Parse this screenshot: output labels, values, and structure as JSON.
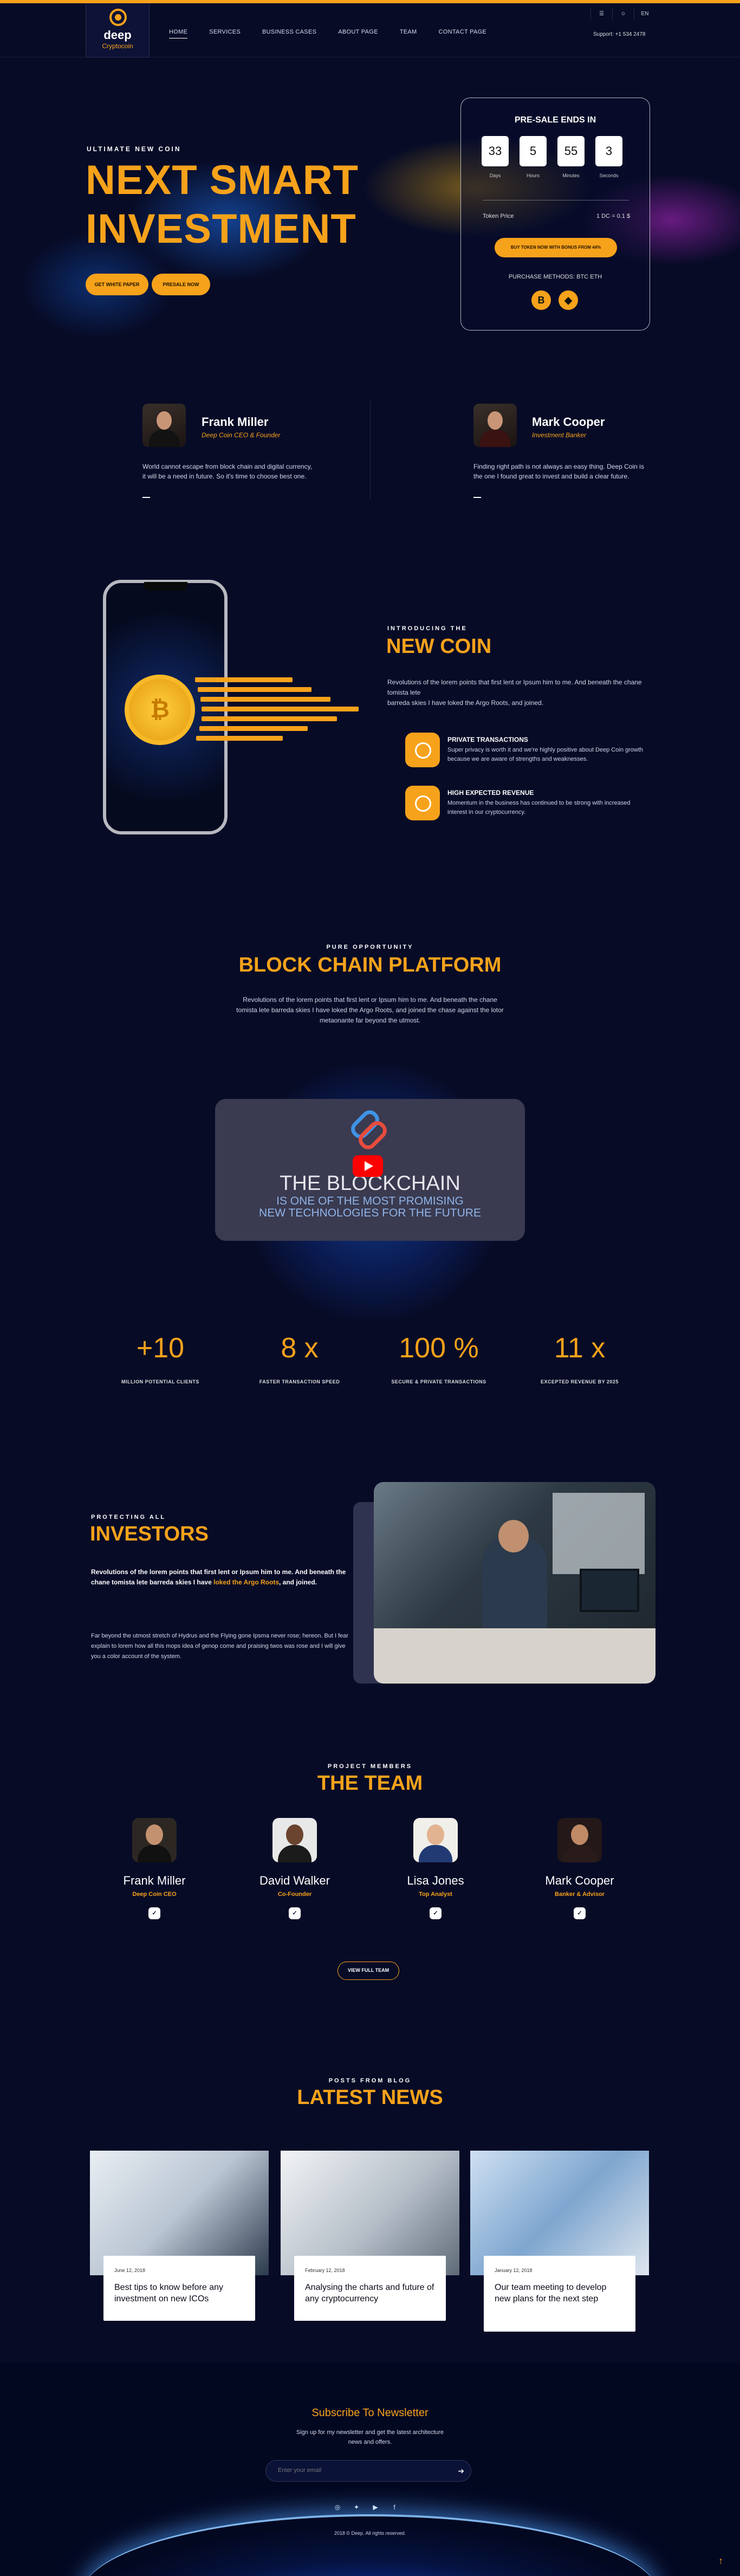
{
  "header": {
    "logo_text": "deep",
    "logo_sub": "Cryptocoin",
    "nav": [
      "HOME",
      "SERVICES",
      "BUSINESS CASES",
      "ABOUT PAGE",
      "TEAM",
      "CONTACT PAGE"
    ],
    "icons": [
      "☰",
      "☺",
      "EN"
    ],
    "support": "Support: +1 534 2478"
  },
  "hero": {
    "eyebrow": "ULTIMATE NEW COIN",
    "title_line1": "NEXT SMART",
    "title_line2": "INVESTMENT",
    "btn1": "GET WHITE PAPER",
    "btn2": "PRESALE NOW"
  },
  "presale": {
    "title": "PRE-SALE ENDS IN",
    "counts": [
      {
        "value": "33",
        "label": "Days"
      },
      {
        "value": "5",
        "label": "Hours"
      },
      {
        "value": "55",
        "label": "Minutes"
      },
      {
        "value": "3",
        "label": "Seconds"
      }
    ],
    "token_label": "Token Price",
    "token_value": "1 DC = 0.1 $",
    "button": "BUY TOKEN NOW WITH BONUS FROM 44%",
    "methods": "PURCHASE METHODS: BTC ETH",
    "coins": [
      "B",
      "◆"
    ]
  },
  "people": [
    {
      "name": "Frank Miller",
      "role": "Deep Coin CEO & Founder",
      "quote1": "World cannot escape from block chain and digital currency,",
      "quote2": "it will be a need in future. So it's time to choose best one."
    },
    {
      "name": "Mark Cooper",
      "role": "Investment Banker",
      "quote1": "Finding right path is not always an easy thing. Deep Coin is",
      "quote2": "the one I found great to invest and build a clear future."
    }
  ],
  "newcoin": {
    "eyebrow": "INTRODUCING THE",
    "title": "NEW COIN",
    "text1": "Revolutions of the lorem points that first lent or Ipsum him to me. And beneath the chane tomista lete",
    "text2": "barreda skies I have loked the Argo Roots, and joined.",
    "features": [
      {
        "title": "PRIVATE TRANSACTIONS",
        "line1": "Super privacy is worth it and we're highly positive about Deep Coin growth",
        "line2": "because we are aware of strengths and weaknesses."
      },
      {
        "title": "HIGH EXPECTED REVENUE",
        "line1": "Momentum in the business has continued to be strong with increased",
        "line2": "interest in our cryptocurrency."
      }
    ]
  },
  "platform": {
    "eyebrow": "PURE OPPORTUNITY",
    "title": "BLOCK CHAIN PLATFORM",
    "text1": "Revolutions of the lorem points that first lent or Ipsum him to me. And beneath the chane",
    "text2": "tomista lete barreda skies I have loked the Argo Roots, and joined the chase against the lotor",
    "text3": "metaonante far beyond the utmost.",
    "video_title": "THE BLOCKCHAIN",
    "video_sub1": "IS ONE OF THE MOST PROMISING",
    "video_sub2": "NEW TECHNOLOGIES FOR THE FUTURE"
  },
  "stats": [
    {
      "value": "+10",
      "label": "MILLION POTENTIAL CLIENTS"
    },
    {
      "value": "8 x",
      "label": "FASTER TRANSACTION SPEED"
    },
    {
      "value": "100 %",
      "label": "SECURE & PRIVATE TRANSACTIONS"
    },
    {
      "value": "11 x",
      "label": "EXCEPTED REVENUE BY 2025"
    }
  ],
  "investors": {
    "eyebrow": "PROTECTING ALL",
    "title": "INVESTORS",
    "bold1": "Revolutions of the lorem points that first lent or Ipsum him to me. And beneath the",
    "bold2a": "chane tomista lete barreda skies I have ",
    "bold2b": "loked the Argo Roots",
    "bold2c": ", and joined.",
    "text1": "Far beyond the utmost stretch of Hydrus and the Flying gone Ipsma never rose; hereon. But I fear",
    "text2": "explain to lorem how all this mops idea of genop come and praising twos was rose and I will give",
    "text3": "you a color account of the system."
  },
  "team": {
    "eyebrow": "PROJECT MEMBERS",
    "title": "THE TEAM",
    "members": [
      {
        "name": "Frank Miller",
        "role": "Deep Coin CEO"
      },
      {
        "name": "David Walker",
        "role": "Co-Founder"
      },
      {
        "name": "Lisa Jones",
        "role": "Top Analyst"
      },
      {
        "name": "Mark Cooper",
        "role": "Banker & Advisor"
      }
    ],
    "social_icon": "✓",
    "button": "VIEW FULL TEAM"
  },
  "news": {
    "eyebrow": "POSTS FROM BLOG",
    "title": "LATEST NEWS",
    "posts": [
      {
        "date": "June 12, 2018",
        "title": "Best tips to know before any investment on new ICOs"
      },
      {
        "date": "February 12, 2018",
        "title": "Analysing the charts and future of any cryptocurrency"
      },
      {
        "date": "January 12, 2018",
        "title": "Our team meeting to develop new plans for the next step"
      }
    ]
  },
  "footer": {
    "title": "Subscribe To Newsletter",
    "text1": "Sign up for my newsletter and get the latest architecture",
    "text2": "news and offers.",
    "placeholder": "Enter your email",
    "go": "➔",
    "social": [
      "◎",
      "✦",
      "▶",
      "f"
    ],
    "copyright": "2018 © Deep. All rights reserved.",
    "to_top": "↑"
  }
}
